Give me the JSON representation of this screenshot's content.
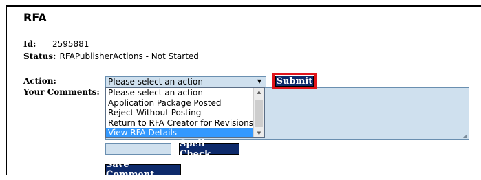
{
  "page": {
    "title": "RFA"
  },
  "info": {
    "id_label": "Id:",
    "id_value": "2595881",
    "status_label": "Status:",
    "status_value": "RFAPublisherActions - Not Started"
  },
  "form": {
    "action_label": "Action:",
    "comments_label": "Your Comments:",
    "action_selected": "Please select an action",
    "action_options": [
      "Please select an action",
      "Application Package Posted",
      "Reject Without Posting",
      "Return to RFA Creator for Revisions",
      "View RFA Details"
    ],
    "highlighted_option_index": 4,
    "submit_label": "Submit",
    "spell_check_label": "Spell Check",
    "save_comment_label": "Save Comment"
  },
  "colors": {
    "button_bg": "#0d2a6b",
    "field_bg": "#cfe0ee",
    "highlight_border": "#e0141b",
    "selected_option": "#3399ff"
  }
}
